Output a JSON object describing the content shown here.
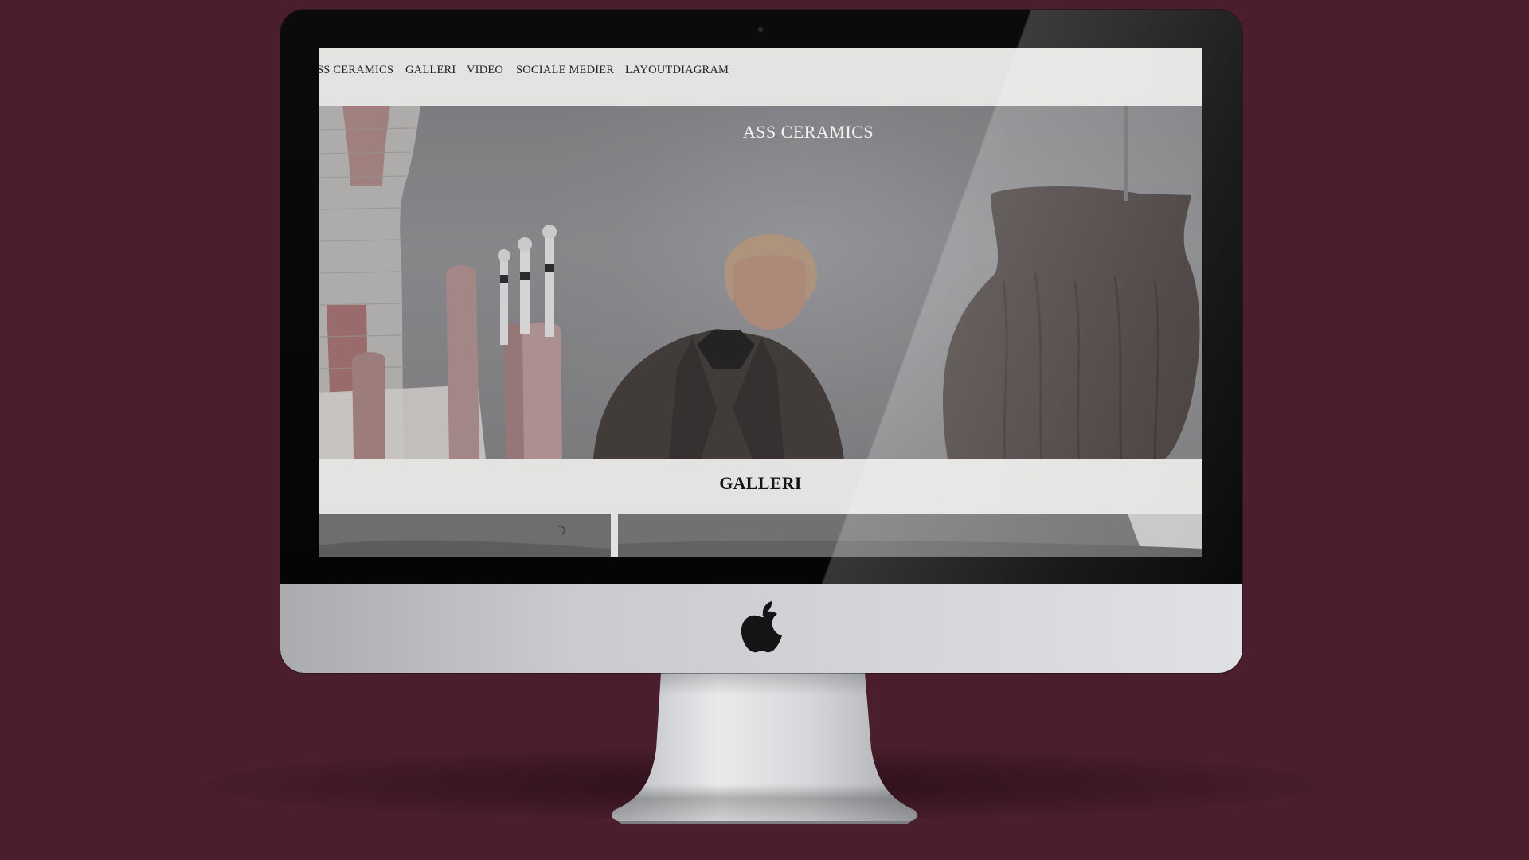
{
  "website": {
    "nav": {
      "items": [
        {
          "label": "SS CERAMICS"
        },
        {
          "label": "GALLERI"
        },
        {
          "label": "VIDEO"
        },
        {
          "label": "SOCIALE MEDIER"
        },
        {
          "label": "LAYOUTDIAGRAM"
        }
      ]
    },
    "hero": {
      "title": "ASS CERAMICS"
    },
    "gallery": {
      "title": "GALLERI"
    }
  },
  "colors": {
    "background": "#4a1e2c",
    "bezel": "#050505",
    "chin": "#c9cbcf",
    "nav_bg": "#e3e3e2",
    "hero_title": "#f4f4f4"
  },
  "icons": {
    "device_logo": "apple-logo-icon",
    "camera": "camera-icon"
  }
}
